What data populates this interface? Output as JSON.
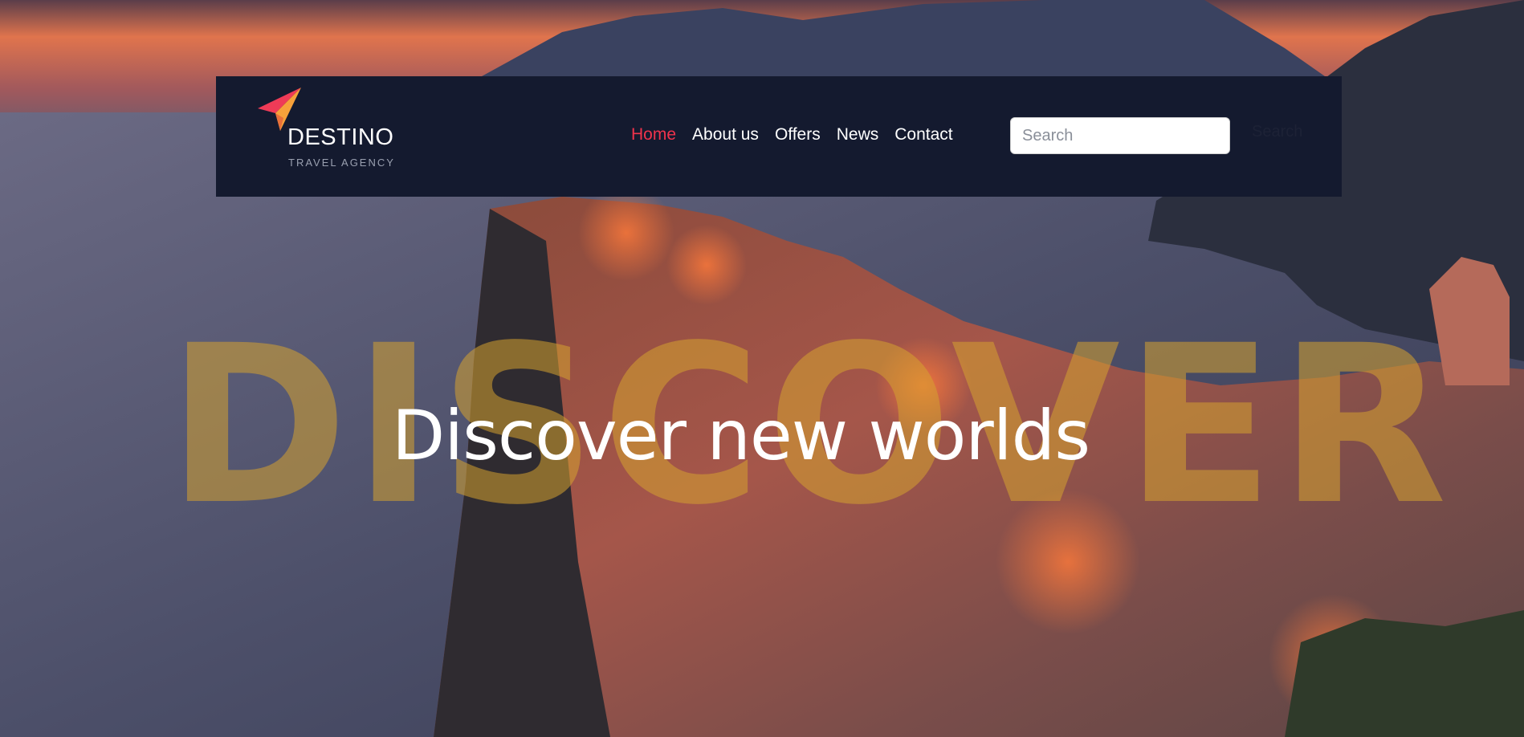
{
  "brand": {
    "name": "DESTINO",
    "tagline": "TRAVEL AGENCY",
    "logo_icon": "paper-plane-icon"
  },
  "nav": {
    "items": [
      {
        "label": "Home",
        "active": true
      },
      {
        "label": "About us",
        "active": false
      },
      {
        "label": "Offers",
        "active": false
      },
      {
        "label": "News",
        "active": false
      },
      {
        "label": "Contact",
        "active": false
      }
    ]
  },
  "search": {
    "placeholder": "Search",
    "value": "",
    "button_label": "Search"
  },
  "hero": {
    "background_word": "DISCOVER",
    "headline": "Discover new worlds"
  },
  "colors": {
    "navbar": "#141a2f",
    "active_link": "#f0334c",
    "background_word": "#d6a330"
  }
}
